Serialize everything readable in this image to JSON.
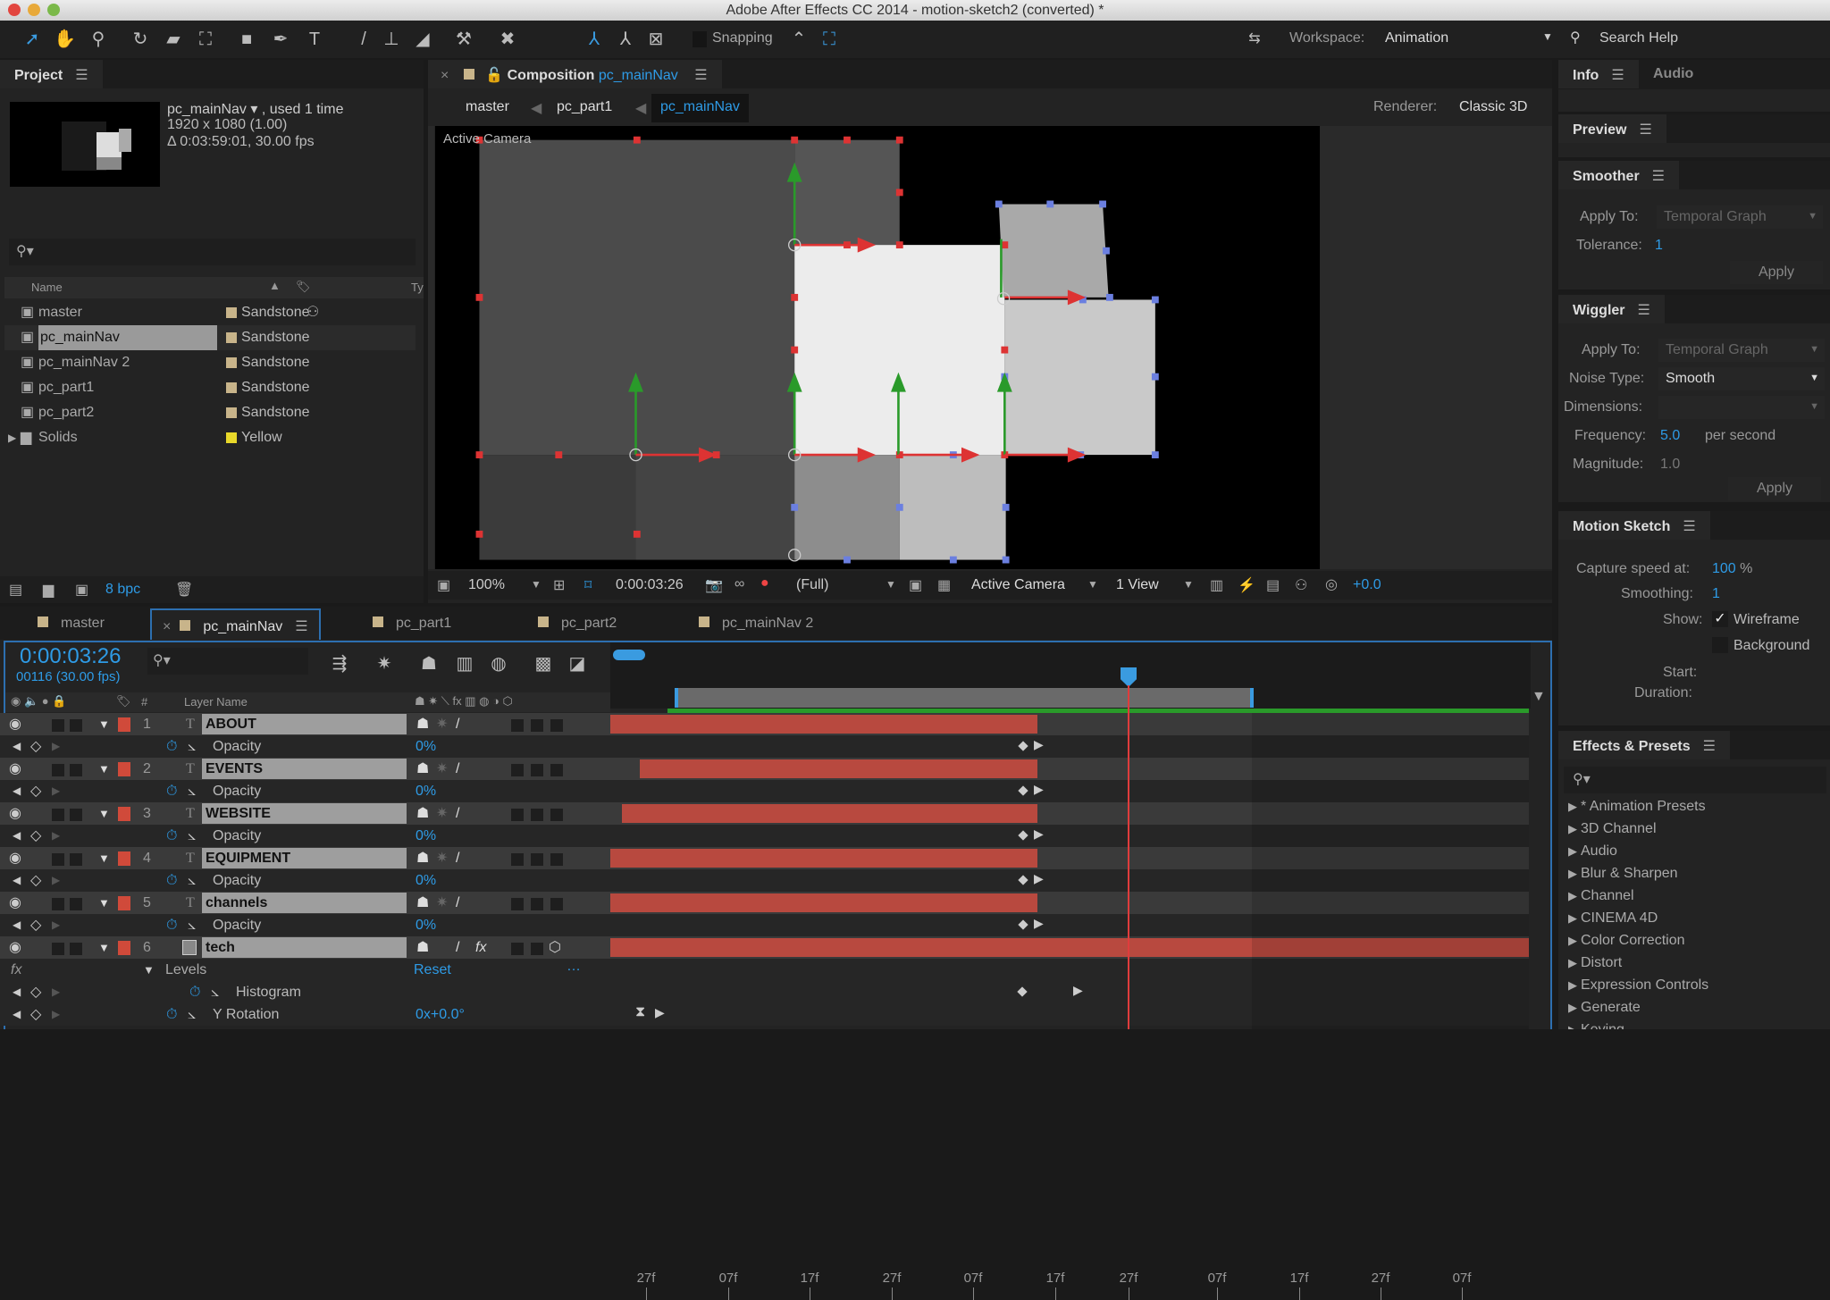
{
  "window": {
    "title": "Adobe After Effects CC 2014 - motion-sketch2 (converted) *"
  },
  "toolbar": {
    "snapping": "Snapping",
    "workspace_label": "Workspace:",
    "workspace_value": "Animation",
    "search_help": "Search Help"
  },
  "project": {
    "tab": "Project",
    "item_name": "pc_mainNav ▾",
    "used": ", used 1 time",
    "dims": "1920 x 1080 (1.00)",
    "duration": "Δ 0:03:59:01, 30.00 fps",
    "col_name": "Name",
    "col_type": "Ty",
    "bpc": "8 bpc",
    "items": [
      {
        "name": "master",
        "label": "Sandstone",
        "color": "#c8b48a"
      },
      {
        "name": "pc_mainNav",
        "label": "Sandstone",
        "color": "#c8b48a"
      },
      {
        "name": "pc_mainNav 2",
        "label": "Sandstone",
        "color": "#c8b48a"
      },
      {
        "name": "pc_part1",
        "label": "Sandstone",
        "color": "#c8b48a"
      },
      {
        "name": "pc_part2",
        "label": "Sandstone",
        "color": "#c8b48a"
      },
      {
        "name": "Solids",
        "label": "Yellow",
        "color": "#e8d82a"
      }
    ]
  },
  "composition": {
    "tab_prefix": "Composition",
    "tab_name": "pc_mainNav",
    "breadcrumbs": [
      "master",
      "pc_part1",
      "pc_mainNav"
    ],
    "renderer_label": "Renderer:",
    "renderer": "Classic 3D",
    "camera_label": "Active Camera",
    "footer": {
      "zoom": "100%",
      "time": "0:00:03:26",
      "resolution": "(Full)",
      "view": "Active Camera",
      "layout": "1 View",
      "exposure": "+0.0"
    }
  },
  "timeline": {
    "tabs": [
      "master",
      "pc_mainNav",
      "pc_part1",
      "pc_part2",
      "pc_mainNav 2"
    ],
    "active_tab": 1,
    "current_time": "0:00:03:26",
    "frame": "00116 (30.00 fps)",
    "col_layer_name": "Layer Name",
    "col_num": "#",
    "ruler": [
      "27f",
      "07f",
      "17f",
      "27f",
      "07f",
      "17f",
      "27f",
      "07f",
      "17f",
      "27f",
      "07f"
    ],
    "rows": [
      {
        "type": "layer",
        "num": "1",
        "name": "ABOUT",
        "text": true
      },
      {
        "type": "prop",
        "name": "Opacity",
        "value": "0%"
      },
      {
        "type": "layer",
        "num": "2",
        "name": "EVENTS",
        "text": true
      },
      {
        "type": "prop",
        "name": "Opacity",
        "value": "0%"
      },
      {
        "type": "layer",
        "num": "3",
        "name": "WEBSITE",
        "text": true
      },
      {
        "type": "prop",
        "name": "Opacity",
        "value": "0%"
      },
      {
        "type": "layer",
        "num": "4",
        "name": "EQUIPMENT",
        "text": true
      },
      {
        "type": "prop",
        "name": "Opacity",
        "value": "0%"
      },
      {
        "type": "layer",
        "num": "5",
        "name": "channels",
        "text": true
      },
      {
        "type": "prop",
        "name": "Opacity",
        "value": "0%"
      },
      {
        "type": "layer",
        "num": "6",
        "name": "tech",
        "text": false
      },
      {
        "type": "effect",
        "name": "Levels",
        "value": "Reset"
      },
      {
        "type": "subprop",
        "name": "Histogram",
        "value": ""
      },
      {
        "type": "prop",
        "name": "Y Rotation",
        "value": "0x+0.0°"
      }
    ]
  },
  "info": {
    "tab": "Info",
    "tab2": "Audio"
  },
  "preview": {
    "title": "Preview"
  },
  "smoother": {
    "title": "Smoother",
    "apply_to_label": "Apply To:",
    "apply_to": "Temporal Graph",
    "tolerance_label": "Tolerance:",
    "tolerance": "1",
    "apply": "Apply"
  },
  "wiggler": {
    "title": "Wiggler",
    "apply_to_label": "Apply To:",
    "apply_to": "Temporal Graph",
    "noise_label": "Noise Type:",
    "noise": "Smooth",
    "dimensions_label": "Dimensions:",
    "frequency_label": "Frequency:",
    "frequency": "5.0",
    "per_second": "per second",
    "magnitude_label": "Magnitude:",
    "magnitude": "1.0",
    "apply": "Apply"
  },
  "motion_sketch": {
    "title": "Motion Sketch",
    "capture_label": "Capture speed at:",
    "capture": "100",
    "percent": "%",
    "smoothing_label": "Smoothing:",
    "smoothing": "1",
    "show_label": "Show:",
    "wireframe": "Wireframe",
    "wireframe_checked": true,
    "background": "Background",
    "background_checked": false,
    "start_label": "Start:",
    "duration_label": "Duration:"
  },
  "effects": {
    "title": "Effects & Presets",
    "items": [
      "* Animation Presets",
      "3D Channel",
      "Audio",
      "Blur & Sharpen",
      "Channel",
      "CINEMA 4D",
      "Color Correction",
      "Distort",
      "Expression Controls",
      "Generate",
      "Keying"
    ]
  }
}
